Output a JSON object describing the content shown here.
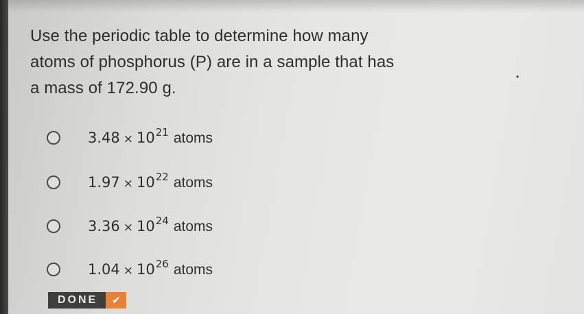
{
  "question": {
    "lines": [
      "Use the periodic table to determine how many",
      "atoms of phosphorus (P) are in a sample that has",
      "a mass of 172.90 g."
    ]
  },
  "options": [
    {
      "mantissa": "3.48",
      "times": "×",
      "base": "10",
      "exponent": "21",
      "unit": "atoms"
    },
    {
      "mantissa": "1.97",
      "times": "×",
      "base": "10",
      "exponent": "22",
      "unit": "atoms"
    },
    {
      "mantissa": "3.36",
      "times": "×",
      "base": "10",
      "exponent": "24",
      "unit": "atoms"
    },
    {
      "mantissa": "1.04",
      "times": "×",
      "base": "10",
      "exponent": "26",
      "unit": "atoms"
    }
  ],
  "done_button": {
    "label": "DONE",
    "icon": "checkmark-icon"
  },
  "colors": {
    "done_bg": "#3e3f3d",
    "done_check_bg": "#e8823a",
    "text": "#2e2e2e"
  }
}
